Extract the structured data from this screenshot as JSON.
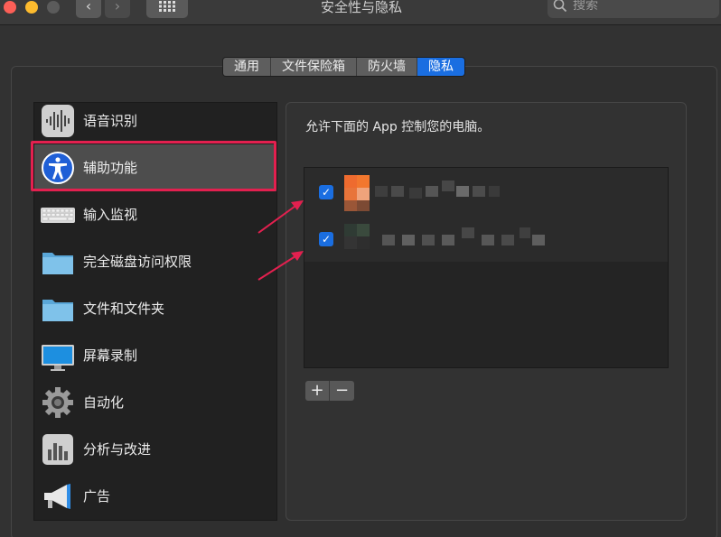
{
  "window": {
    "title": "安全性与隐私",
    "back_glyph": "‹",
    "forward_glyph": "›"
  },
  "search": {
    "placeholder": "搜索"
  },
  "tabs": [
    {
      "label": "通用",
      "active": false
    },
    {
      "label": "文件保险箱",
      "active": false
    },
    {
      "label": "防火墙",
      "active": false
    },
    {
      "label": "隐私",
      "active": true
    }
  ],
  "sidebar": {
    "items": [
      {
        "label": "语音识别",
        "icon": "speech-waveform-icon"
      },
      {
        "label": "辅助功能",
        "icon": "accessibility-icon",
        "selected": true
      },
      {
        "label": "输入监视",
        "icon": "keyboard-icon"
      },
      {
        "label": "完全磁盘访问权限",
        "icon": "folder-icon"
      },
      {
        "label": "文件和文件夹",
        "icon": "folder-icon"
      },
      {
        "label": "屏幕录制",
        "icon": "display-icon"
      },
      {
        "label": "自动化",
        "icon": "gear-icon"
      },
      {
        "label": "分析与改进",
        "icon": "bar-chart-icon"
      },
      {
        "label": "广告",
        "icon": "megaphone-icon"
      }
    ]
  },
  "main": {
    "description": "允许下面的 App 控制您的电脑。",
    "apps": [
      {
        "checked": true,
        "check_glyph": "✓"
      },
      {
        "checked": true,
        "check_glyph": "✓"
      }
    ],
    "add_label": "+",
    "remove_label": "−"
  },
  "colors": {
    "accent": "#1a6ee1",
    "highlight": "#e3204f"
  }
}
